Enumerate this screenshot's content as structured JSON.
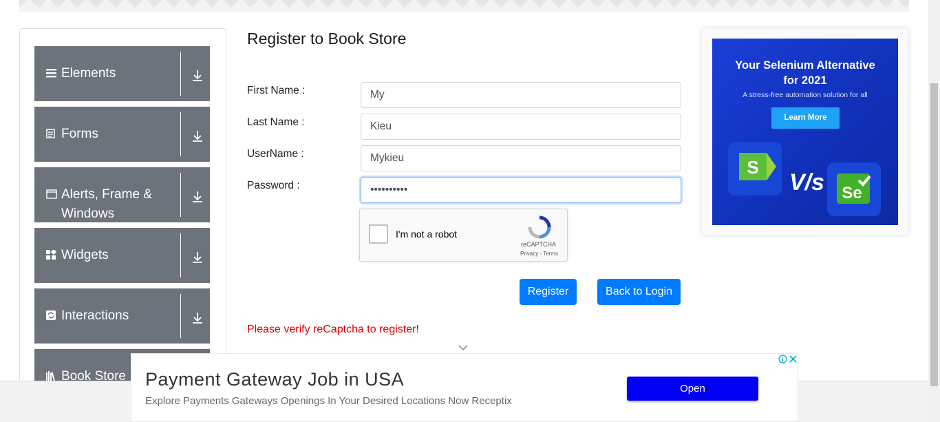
{
  "sidebar": {
    "groups": [
      {
        "label": "Elements",
        "icon": "hamburger-icon"
      },
      {
        "label": "Forms",
        "icon": "document-icon"
      },
      {
        "label": "Alerts, Frame & Windows",
        "icon": "window-icon"
      },
      {
        "label": "Widgets",
        "icon": "widgets-icon"
      },
      {
        "label": "Interactions",
        "icon": "interactions-icon"
      },
      {
        "label": "Book Store",
        "icon": "books-icon"
      }
    ]
  },
  "form": {
    "title": "Register to Book Store",
    "first_name_label": "First Name :",
    "first_name_value": "My",
    "last_name_label": "Last Name :",
    "last_name_value": "Kieu",
    "username_label": "UserName :",
    "username_value": "Mykieu",
    "password_label": "Password :",
    "password_value": "••••••••••",
    "recaptcha_text": "I'm not a robot",
    "recaptcha_brand": "reCAPTCHA",
    "recaptcha_terms": "Privacy - Terms",
    "register_button": "Register",
    "back_button": "Back to Login",
    "error_message": "Please verify reCaptcha to register!"
  },
  "side_ad": {
    "headline_line1": "Your Selenium Alternative",
    "headline_line2": "for 2021",
    "subtitle": "A stress-free automation solution for all",
    "cta": "Learn More",
    "vs_text": "V/s"
  },
  "bottom_ad": {
    "headline": "Payment Gateway Job in USA",
    "subtitle": "Explore Payments Gateways Openings In Your Desired Locations Now Receptix",
    "cta": "Open"
  },
  "colors": {
    "sidebar_group": "#6c737b",
    "primary": "#007bff",
    "error": "#dc0000",
    "ad_blue": "#1b3fd8",
    "ad_button": "#0000f5"
  }
}
